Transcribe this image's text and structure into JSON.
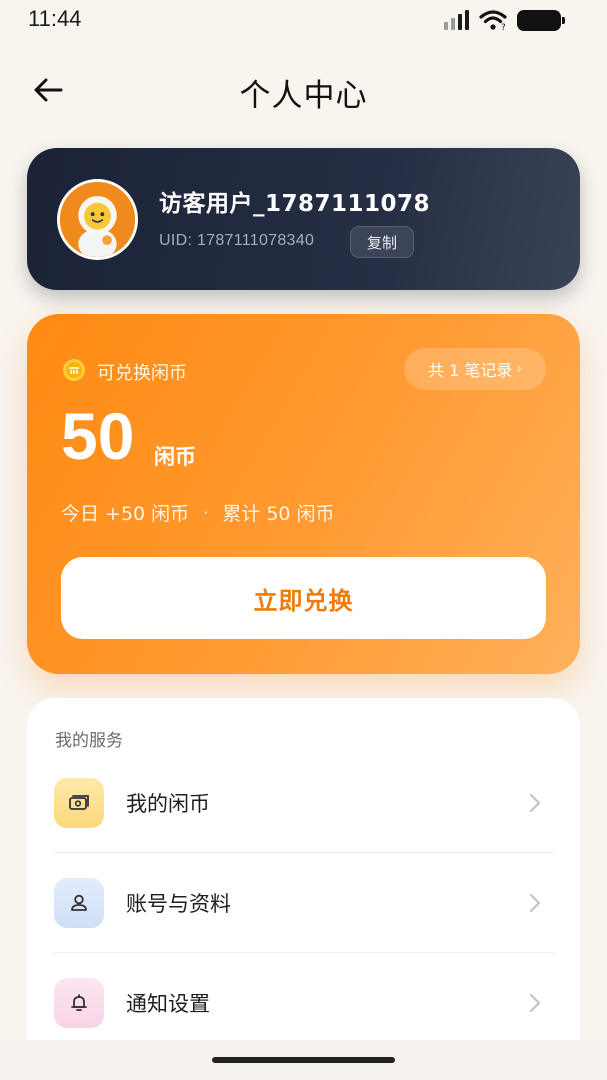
{
  "status_bar": {
    "time": "11:44"
  },
  "nav": {
    "title": "个人中心"
  },
  "profile": {
    "name": "访客用户_1787111078",
    "uid": "UID: 1787111078340",
    "copy_label": "复制"
  },
  "coins": {
    "label": "可兑换闲币",
    "records_label": "共 1 笔记录",
    "amount": "50",
    "unit": "闲币",
    "today": "今日 +50 闲币",
    "separator": "·",
    "total": "累计 50 闲币",
    "redeem_label": "立即兑换"
  },
  "services": {
    "title": "我的服务",
    "items": [
      {
        "label": "我的闲币",
        "icon": "wallet-icon",
        "color": "#fde8a6"
      },
      {
        "label": "账号与资料",
        "icon": "user-icon",
        "color": "#dbe7fb"
      },
      {
        "label": "通知设置",
        "icon": "bell-icon",
        "color": "#fbe0ee"
      }
    ]
  },
  "colors": {
    "accent": "#ff8a12",
    "profile_card": "#1b2236",
    "background": "#f8f4ee"
  }
}
